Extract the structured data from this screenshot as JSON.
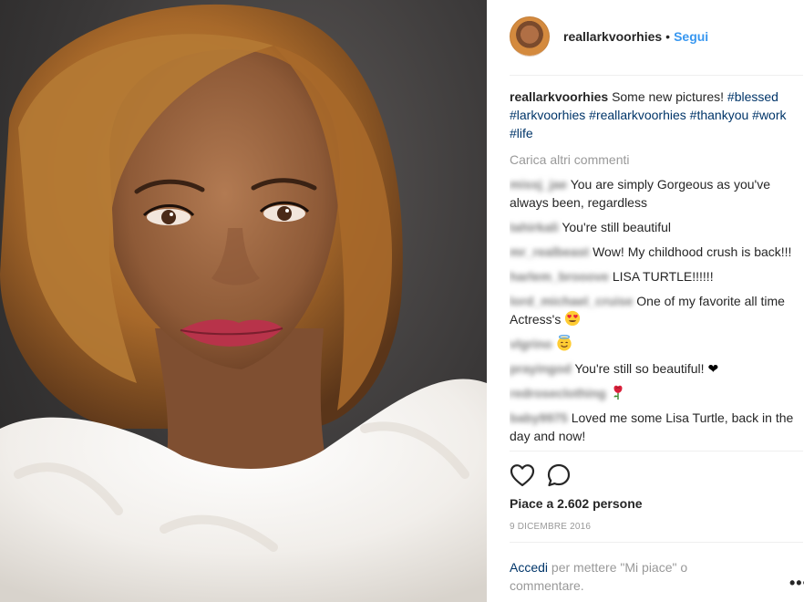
{
  "post": {
    "username": "reallarkvoorhies",
    "separator": "•",
    "follow_label": "Segui",
    "caption_text": "Some new pictures!",
    "hashtags": [
      "#blessed",
      "#larkvoorhies",
      "#reallarkvoorhies",
      "#thankyou",
      "#work",
      "#life"
    ],
    "load_more_label": "Carica altri commenti"
  },
  "comments": [
    {
      "author": "missj_jae",
      "text": "You are simply Gorgeous as you've always been, regardless"
    },
    {
      "author": "tahirkali",
      "text": "You're still beautiful"
    },
    {
      "author": "mr_realbeast",
      "text": "Wow! My childhood crush is back!!!"
    },
    {
      "author": "harlem_brooove",
      "text": "LISA TURTLE!!!!!!"
    },
    {
      "author": "lord_michael_cruise",
      "text": "One of my favorite all time Actress's",
      "emoji": "heart-eyes-emoji"
    },
    {
      "author": "vlgrino",
      "text": "",
      "emoji": "smiling-halo-emoji"
    },
    {
      "author": "prayingod",
      "text": "You're still so beautiful!",
      "emoji": "black-heart-emoji",
      "emoji_char": "❤"
    },
    {
      "author": "redroseclothing",
      "text": "",
      "emoji": "rose-emoji"
    },
    {
      "author": "baby9975",
      "text": "Loved me some Lisa Turtle, back in the day and now!"
    }
  ],
  "stats": {
    "likes_label": "Piace a 2.602 persone",
    "date_label": "9 dicembre 2016"
  },
  "footer": {
    "login_link": "Accedi",
    "login_text": "per mettere \"Mi piace\" o commentare.",
    "more_label": "•••"
  },
  "icons": {
    "like": "heart-outline-icon",
    "comment": "speech-bubble-icon",
    "more": "ellipsis-icon"
  },
  "colors": {
    "link_blue": "#3897f0",
    "hashtag_blue": "#003569",
    "muted_gray": "#999999",
    "text": "#262626"
  }
}
